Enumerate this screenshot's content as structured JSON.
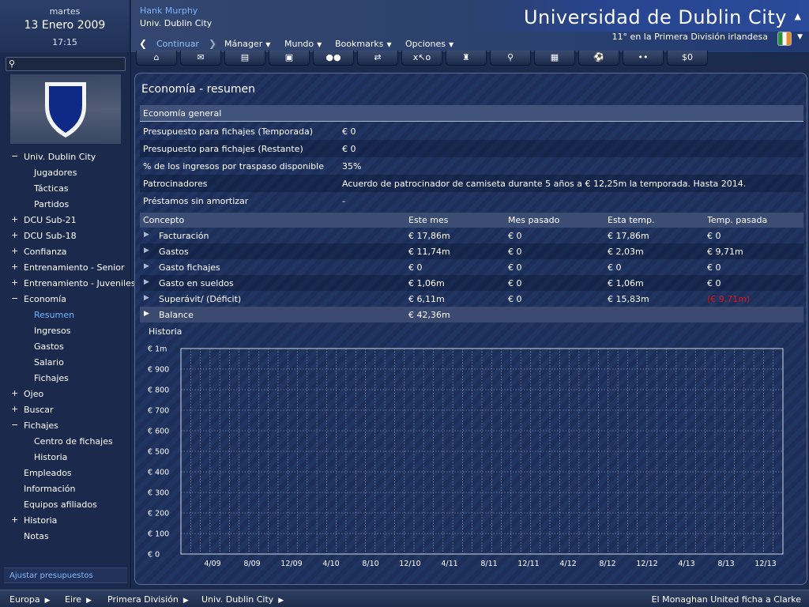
{
  "date": {
    "weekday": "martes",
    "date": "13 Enero 2009",
    "time": "17:15"
  },
  "header": {
    "manager": "Hank Murphy",
    "club_short": "Univ. Dublin City",
    "club_title": "Universidad de Dublin City",
    "league_position": "11° en la Primera División irlandesa"
  },
  "menu": {
    "continue": "Continuar",
    "items": [
      "Mánager",
      "Mundo",
      "Bookmarks",
      "Opciones"
    ]
  },
  "toolbar": {
    "icons": [
      "home-icon",
      "mail-icon",
      "squad-icon",
      "calendar-icon",
      "people-icon",
      "transfer-icon",
      "tactics-icon",
      "trophy-icon",
      "search-icon",
      "notes-icon",
      "training-icon",
      "scout-icon"
    ],
    "finance_label": "$0"
  },
  "sidebar": {
    "search_placeholder": "",
    "items": [
      {
        "label": "Univ. Dublin City",
        "exp": "−",
        "indent": 0,
        "active": false
      },
      {
        "label": "Jugadores",
        "exp": "",
        "indent": 1,
        "active": false
      },
      {
        "label": "Tácticas",
        "exp": "",
        "indent": 1,
        "active": false
      },
      {
        "label": "Partidos",
        "exp": "",
        "indent": 1,
        "active": false
      },
      {
        "label": "DCU Sub-21",
        "exp": "+",
        "indent": 0,
        "active": false
      },
      {
        "label": "DCU Sub-18",
        "exp": "+",
        "indent": 0,
        "active": false
      },
      {
        "label": "Confianza",
        "exp": "+",
        "indent": 0,
        "active": false
      },
      {
        "label": "Entrenamiento - Senior",
        "exp": "+",
        "indent": 0,
        "active": false
      },
      {
        "label": "Entrenamiento - Juveniles",
        "exp": "+",
        "indent": 0,
        "active": false
      },
      {
        "label": "Economía",
        "exp": "−",
        "indent": 0,
        "active": false
      },
      {
        "label": "Resumen",
        "exp": "",
        "indent": 1,
        "active": true
      },
      {
        "label": "Ingresos",
        "exp": "",
        "indent": 1,
        "active": false
      },
      {
        "label": "Gastos",
        "exp": "",
        "indent": 1,
        "active": false
      },
      {
        "label": "Salario",
        "exp": "",
        "indent": 1,
        "active": false
      },
      {
        "label": "Fichajes",
        "exp": "",
        "indent": 1,
        "active": false
      },
      {
        "label": "Ojeo",
        "exp": "+",
        "indent": 0,
        "active": false
      },
      {
        "label": "Buscar",
        "exp": "+",
        "indent": 0,
        "active": false
      },
      {
        "label": "Fichajes",
        "exp": "−",
        "indent": 0,
        "active": false
      },
      {
        "label": "Centro de fichajes",
        "exp": "",
        "indent": 1,
        "active": false
      },
      {
        "label": "Historia",
        "exp": "",
        "indent": 1,
        "active": false
      },
      {
        "label": "Empleados",
        "exp": "",
        "indent": 0,
        "active": false
      },
      {
        "label": "Información",
        "exp": "",
        "indent": 0,
        "active": false
      },
      {
        "label": "Equipos afiliados",
        "exp": "",
        "indent": 0,
        "active": false
      },
      {
        "label": "Historia",
        "exp": "+",
        "indent": 0,
        "active": false
      },
      {
        "label": "Notas",
        "exp": "",
        "indent": 0,
        "active": false
      }
    ],
    "adjust_budget": "Ajustar presupuestos"
  },
  "main": {
    "title": "Economía - resumen",
    "general_heading": "Economía general",
    "general_rows": [
      {
        "label": "Presupuesto para fichajes (Temporada)",
        "value": "€ 0"
      },
      {
        "label": "Presupuesto para fichajes (Restante)",
        "value": "€ 0"
      },
      {
        "label": "% de los ingresos por traspaso disponible",
        "value": "35%"
      },
      {
        "label": "Patrocinadores",
        "value": "Acuerdo de patrocinador de camiseta durante 5 años a € 12,25m la temporada. Hasta 2014."
      },
      {
        "label": "Préstamos sin amortizar",
        "value": "-"
      }
    ],
    "finance_columns": [
      "Concepto",
      "Este mes",
      "Mes pasado",
      "Esta temp.",
      "Temp. pasada"
    ],
    "finance_rows": [
      {
        "concept": "Facturación",
        "este_mes": "€ 17,86m",
        "mes_pasado": "€ 0",
        "esta_temp": "€ 17,86m",
        "temp_pasada": "€ 0",
        "negative": false
      },
      {
        "concept": "Gastos",
        "este_mes": "€ 11,74m",
        "mes_pasado": "€ 0",
        "esta_temp": "€ 2,03m",
        "temp_pasada": "€ 9,71m",
        "negative": false
      },
      {
        "concept": "Gasto fichajes",
        "este_mes": "€ 0",
        "mes_pasado": "€ 0",
        "esta_temp": "€ 0",
        "temp_pasada": "€ 0",
        "negative": false
      },
      {
        "concept": "Gasto en sueldos",
        "este_mes": "€ 1,06m",
        "mes_pasado": "€ 0",
        "esta_temp": "€ 1,06m",
        "temp_pasada": "€ 0",
        "negative": false
      },
      {
        "concept": "Superávit/ (Déficit)",
        "este_mes": "€ 6,11m",
        "mes_pasado": "€ 0",
        "esta_temp": "€ 15,83m",
        "temp_pasada": "(€ 9,71m)",
        "negative": true
      }
    ],
    "balance": {
      "concept": "Balance",
      "value": "€ 42,36m"
    },
    "negative_color": "#e0121a"
  },
  "chart_data": {
    "type": "line",
    "title": "Historia",
    "x_ticks": [
      "4/09",
      "8/09",
      "12/09",
      "4/10",
      "8/10",
      "12/10",
      "4/11",
      "8/11",
      "12/11",
      "4/12",
      "8/12",
      "12/12",
      "4/13",
      "8/13",
      "12/13"
    ],
    "y_ticks": [
      "€ 0",
      "€ 100",
      "€ 200",
      "€ 300",
      "€ 400",
      "€ 500",
      "€ 600",
      "€ 700",
      "€ 800",
      "€ 900",
      "€ 1m"
    ],
    "ylim": [
      0,
      1000
    ],
    "grid": true,
    "series": []
  },
  "bottombar": {
    "crumbs": [
      "Europa",
      "Eire",
      "Primera División",
      "Univ. Dublin City"
    ],
    "news": "El Monaghan United ficha a Clarke"
  }
}
